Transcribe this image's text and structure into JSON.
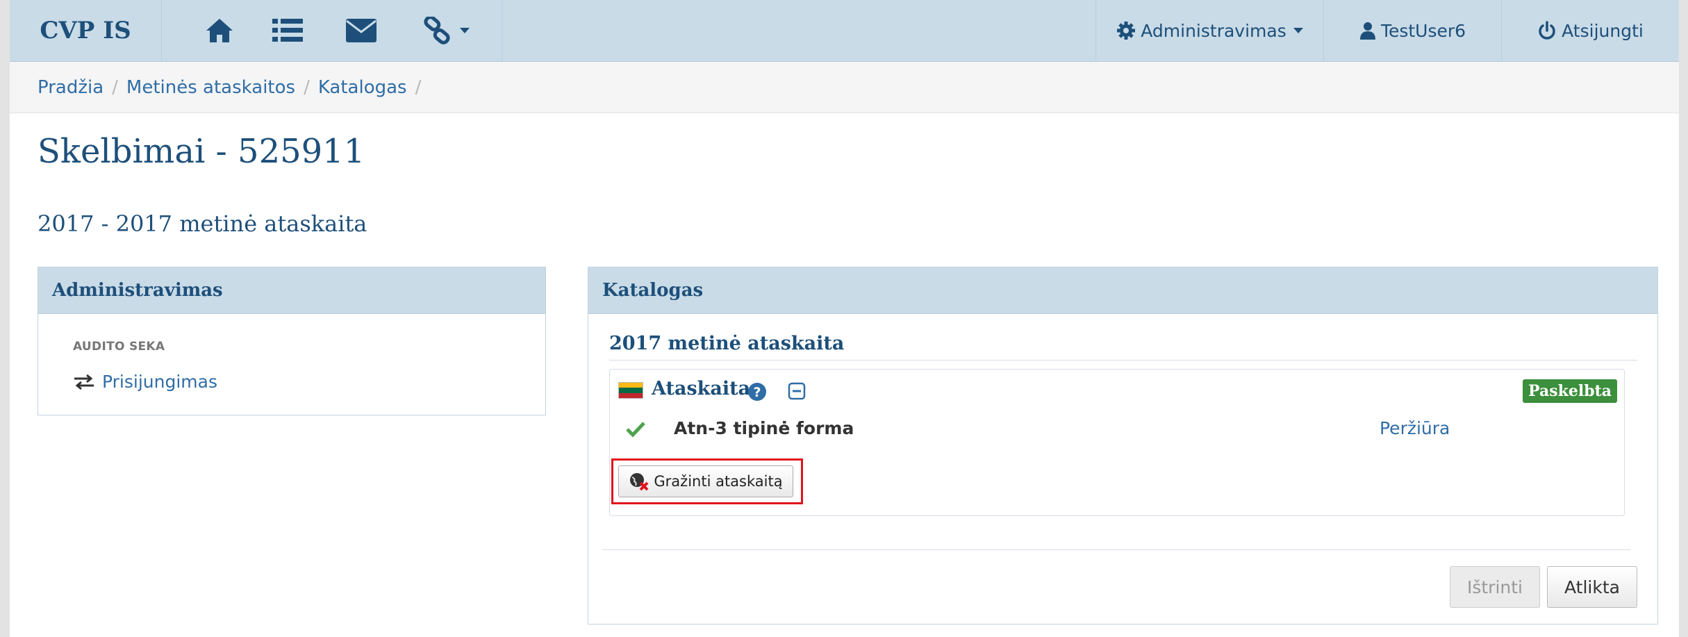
{
  "navbar": {
    "brand": "CVP IS",
    "admin_label": "Administravimas",
    "user_label": "TestUser6",
    "logout_label": "Atsijungti"
  },
  "breadcrumb": {
    "items": [
      "Pradžia",
      "Metinės ataskaitos",
      "Katalogas"
    ],
    "separator": "/"
  },
  "page": {
    "title": "Skelbimai - 525911",
    "subtitle": "2017 - 2017 metinė ataskaita"
  },
  "admin_panel": {
    "heading": "Administravimas",
    "section_label": "AUDITO SEKA",
    "link": "Prisijungimas"
  },
  "catalog_panel": {
    "heading": "Katalogas",
    "report_title": "2017 metinė ataskaita",
    "report": {
      "name": "Ataskaita",
      "status": "Paskelbta",
      "status_color": "#3c8f3c",
      "form_name": "Atn-3 tipinė forma",
      "preview_link": "Peržiūra",
      "return_button": "Gražinti ataskaitą"
    },
    "delete_button": "Ištrinti",
    "done_button": "Atlikta"
  },
  "colors": {
    "navbar_bg": "#c9dbe7",
    "link": "#2f6da6",
    "heading": "#1d4f7a",
    "highlight_border": "#e0141e"
  },
  "icons": {
    "nav": [
      "home-icon",
      "list-icon",
      "envelope-icon",
      "link-icon"
    ],
    "admin": "gear-icon",
    "user": "user-icon",
    "logout": "power-icon"
  }
}
